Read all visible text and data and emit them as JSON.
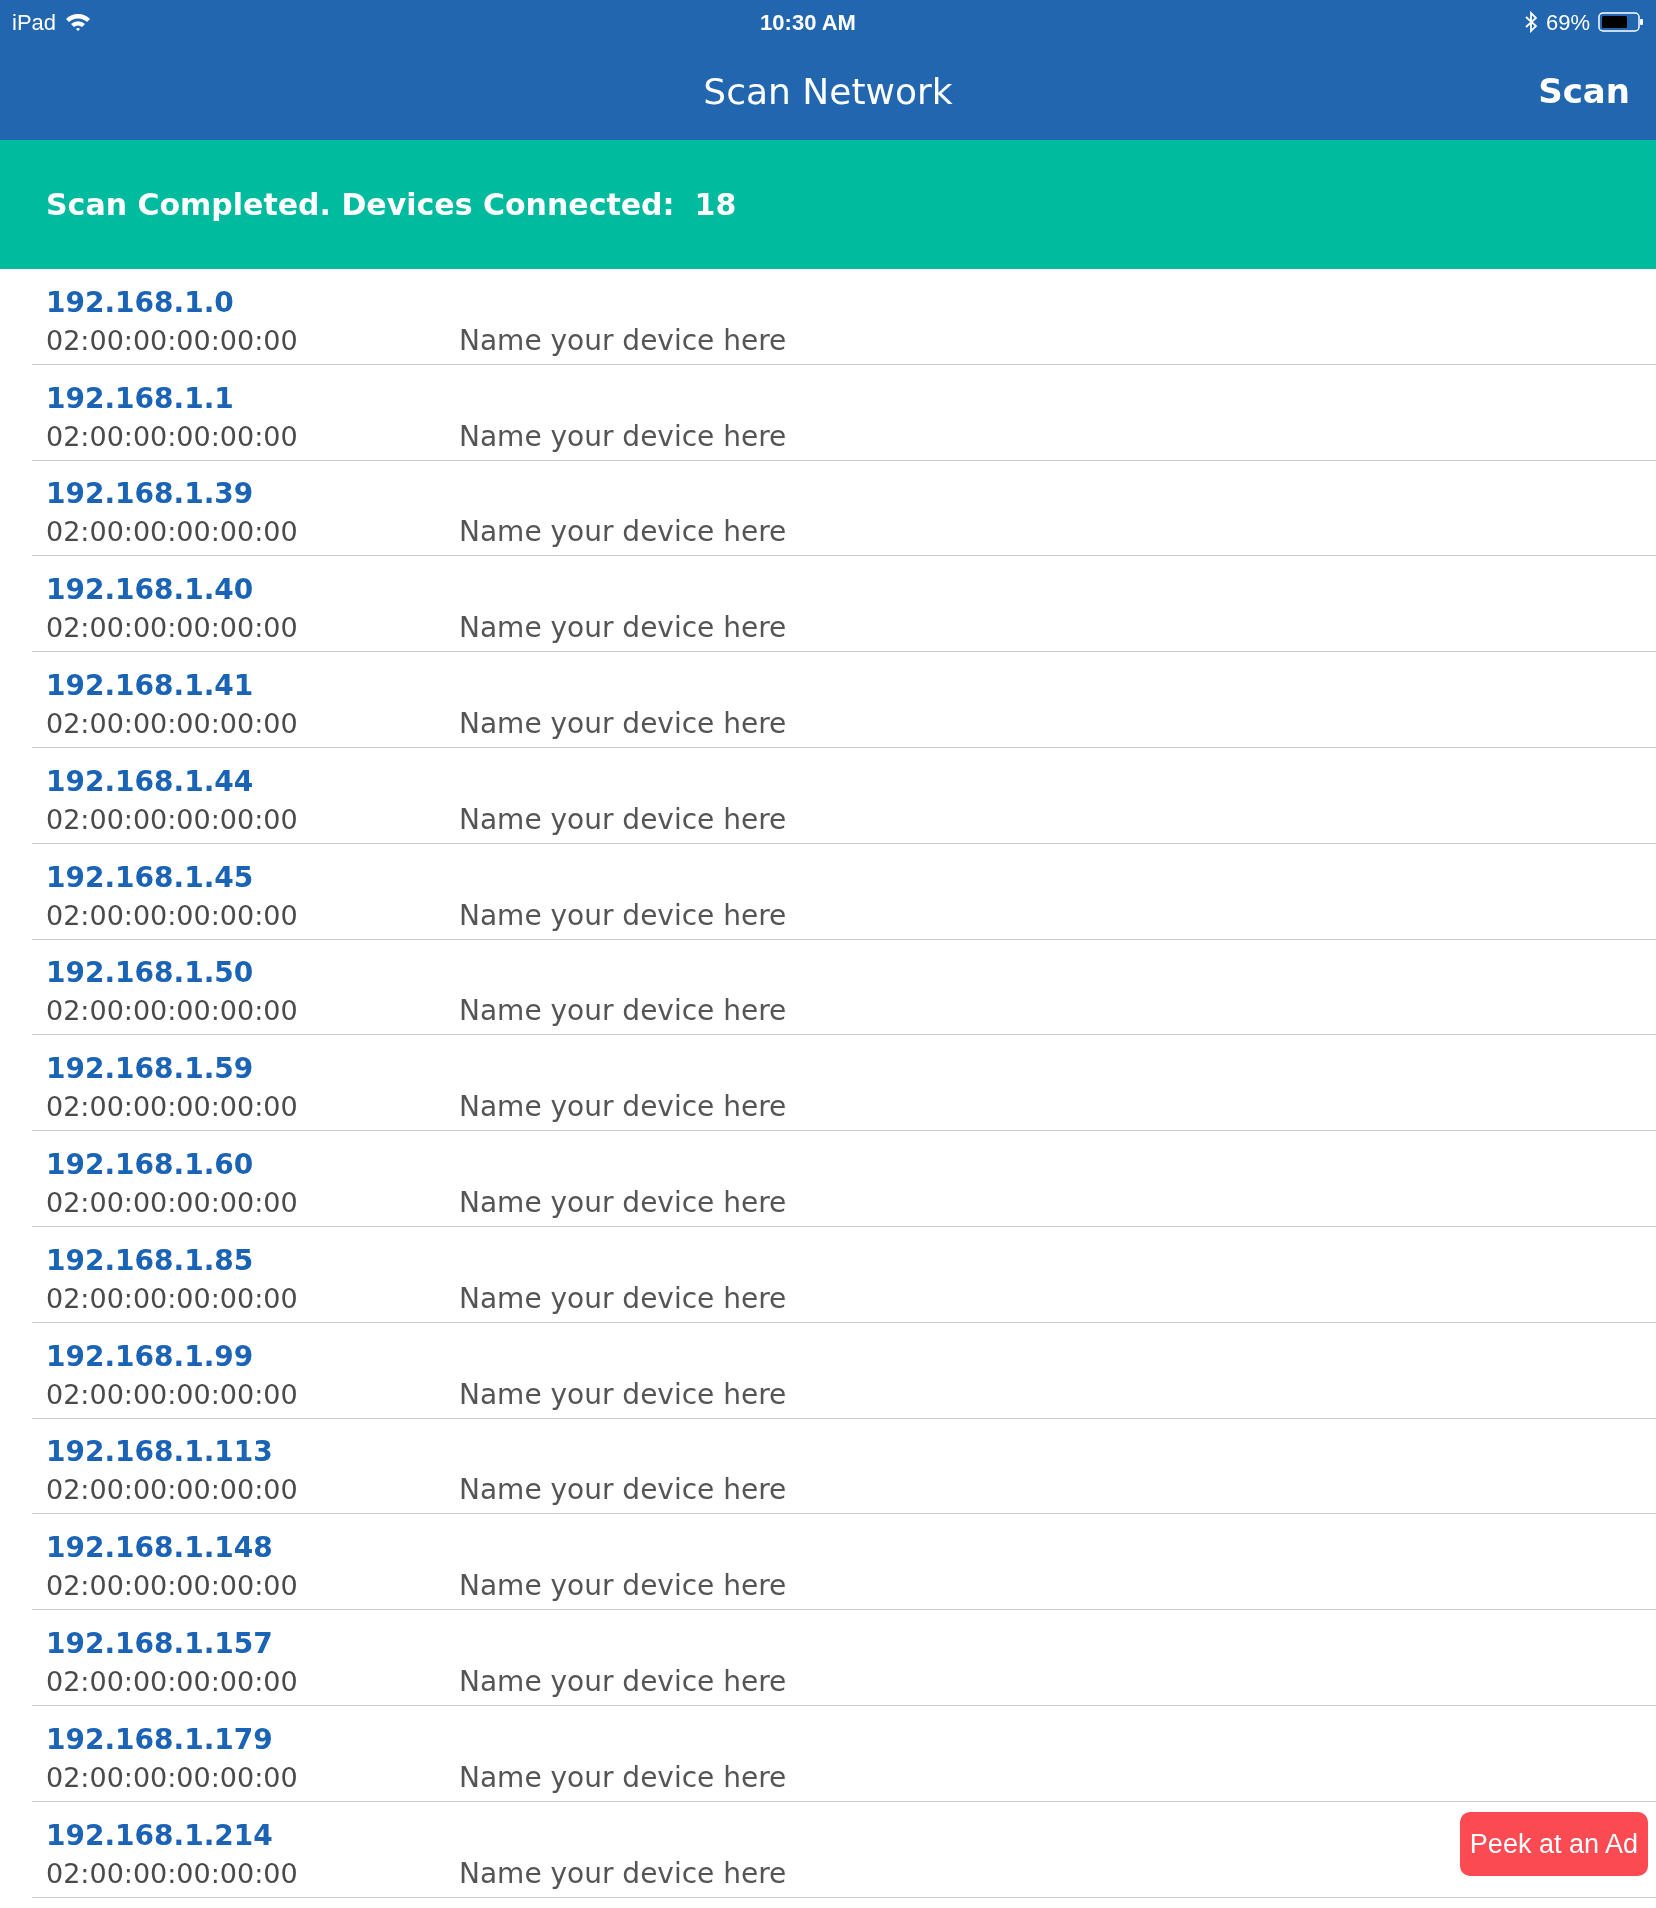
{
  "status_bar": {
    "device": "iPad",
    "time": "10:30 AM",
    "battery": "69%"
  },
  "nav_bar": {
    "title": "Scan Network",
    "action": "Scan"
  },
  "banner": {
    "message": "Scan Completed. Devices Connected:",
    "count": "18"
  },
  "devices": [
    {
      "ip": "192.168.1.0",
      "mac": "02:00:00:00:00:00",
      "placeholder": "Name your device here"
    },
    {
      "ip": "192.168.1.1",
      "mac": "02:00:00:00:00:00",
      "placeholder": "Name your device here"
    },
    {
      "ip": "192.168.1.39",
      "mac": "02:00:00:00:00:00",
      "placeholder": "Name your device here"
    },
    {
      "ip": "192.168.1.40",
      "mac": "02:00:00:00:00:00",
      "placeholder": "Name your device here"
    },
    {
      "ip": "192.168.1.41",
      "mac": "02:00:00:00:00:00",
      "placeholder": "Name your device here"
    },
    {
      "ip": "192.168.1.44",
      "mac": "02:00:00:00:00:00",
      "placeholder": "Name your device here"
    },
    {
      "ip": "192.168.1.45",
      "mac": "02:00:00:00:00:00",
      "placeholder": "Name your device here"
    },
    {
      "ip": "192.168.1.50",
      "mac": "02:00:00:00:00:00",
      "placeholder": "Name your device here"
    },
    {
      "ip": "192.168.1.59",
      "mac": "02:00:00:00:00:00",
      "placeholder": "Name your device here"
    },
    {
      "ip": "192.168.1.60",
      "mac": "02:00:00:00:00:00",
      "placeholder": "Name your device here"
    },
    {
      "ip": "192.168.1.85",
      "mac": "02:00:00:00:00:00",
      "placeholder": "Name your device here"
    },
    {
      "ip": "192.168.1.99",
      "mac": "02:00:00:00:00:00",
      "placeholder": "Name your device here"
    },
    {
      "ip": "192.168.1.113",
      "mac": "02:00:00:00:00:00",
      "placeholder": "Name your device here"
    },
    {
      "ip": "192.168.1.148",
      "mac": "02:00:00:00:00:00",
      "placeholder": "Name your device here"
    },
    {
      "ip": "192.168.1.157",
      "mac": "02:00:00:00:00:00",
      "placeholder": "Name your device here"
    },
    {
      "ip": "192.168.1.179",
      "mac": "02:00:00:00:00:00",
      "placeholder": "Name your device here"
    },
    {
      "ip": "192.168.1.214",
      "mac": "02:00:00:00:00:00",
      "placeholder": "Name your device here"
    }
  ],
  "ad_button": {
    "label": "Peek at an Ad"
  }
}
